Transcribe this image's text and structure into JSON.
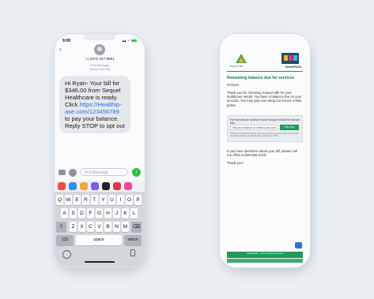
{
  "colors": {
    "background": "#e9eef3",
    "ios_blue": "#1a73e8",
    "send_green": "#2fbf4a",
    "email_green": "#1f9a5a",
    "brand_navy": "#27466e"
  },
  "sms": {
    "status_time": "9:09",
    "contact_number": "+1 (872) 257-9601",
    "message_label": "Text Message",
    "message_time": "Today 8:58 AM",
    "body_before_link": "Hi Ryan- Your bill for $346.00 from Sequel Healthcare is ready. Click ",
    "link": "https://Healthip-ase.com/123456789",
    "body_after_link": " to pay your balance. Reply STOP to opt out",
    "input_placeholder": "Text Message",
    "keyboard": {
      "row1": [
        "Q",
        "W",
        "E",
        "R",
        "T",
        "Y",
        "U",
        "I",
        "O",
        "P"
      ],
      "row2": [
        "A",
        "S",
        "D",
        "F",
        "G",
        "H",
        "J",
        "K",
        "L"
      ],
      "row3": [
        "Z",
        "X",
        "C",
        "V",
        "B",
        "N",
        "M"
      ],
      "numbers_key": "123",
      "space_key": "space",
      "return_key": "return"
    }
  },
  "email": {
    "brand_left": "sequel hlth",
    "brand_right": "HealthiPASS",
    "title": "Remaining balance due for services",
    "greeting": "Hi Ryan,",
    "paragraph1": "Thank you for choosing Sequel Hlth for your healthcare needs. You have a balance due on your account. You may pay now using our secure online portal.",
    "paybox_header": "For fast secure access to your bill go to click the secure link",
    "paybox_field": "Pay your balance at healthip.ase.com",
    "paybox_button": "Pay now",
    "paybox_fine": "Protect yourself from fraud. Pay only using our secure link. If you have questions about your bill please contact our office.",
    "paragraph2": "If you have questions about your bill, please call our office at 800-555-0100.",
    "signoff": "Thank you!",
    "footer_text": "HealthiPASS · Secure patient payments"
  }
}
